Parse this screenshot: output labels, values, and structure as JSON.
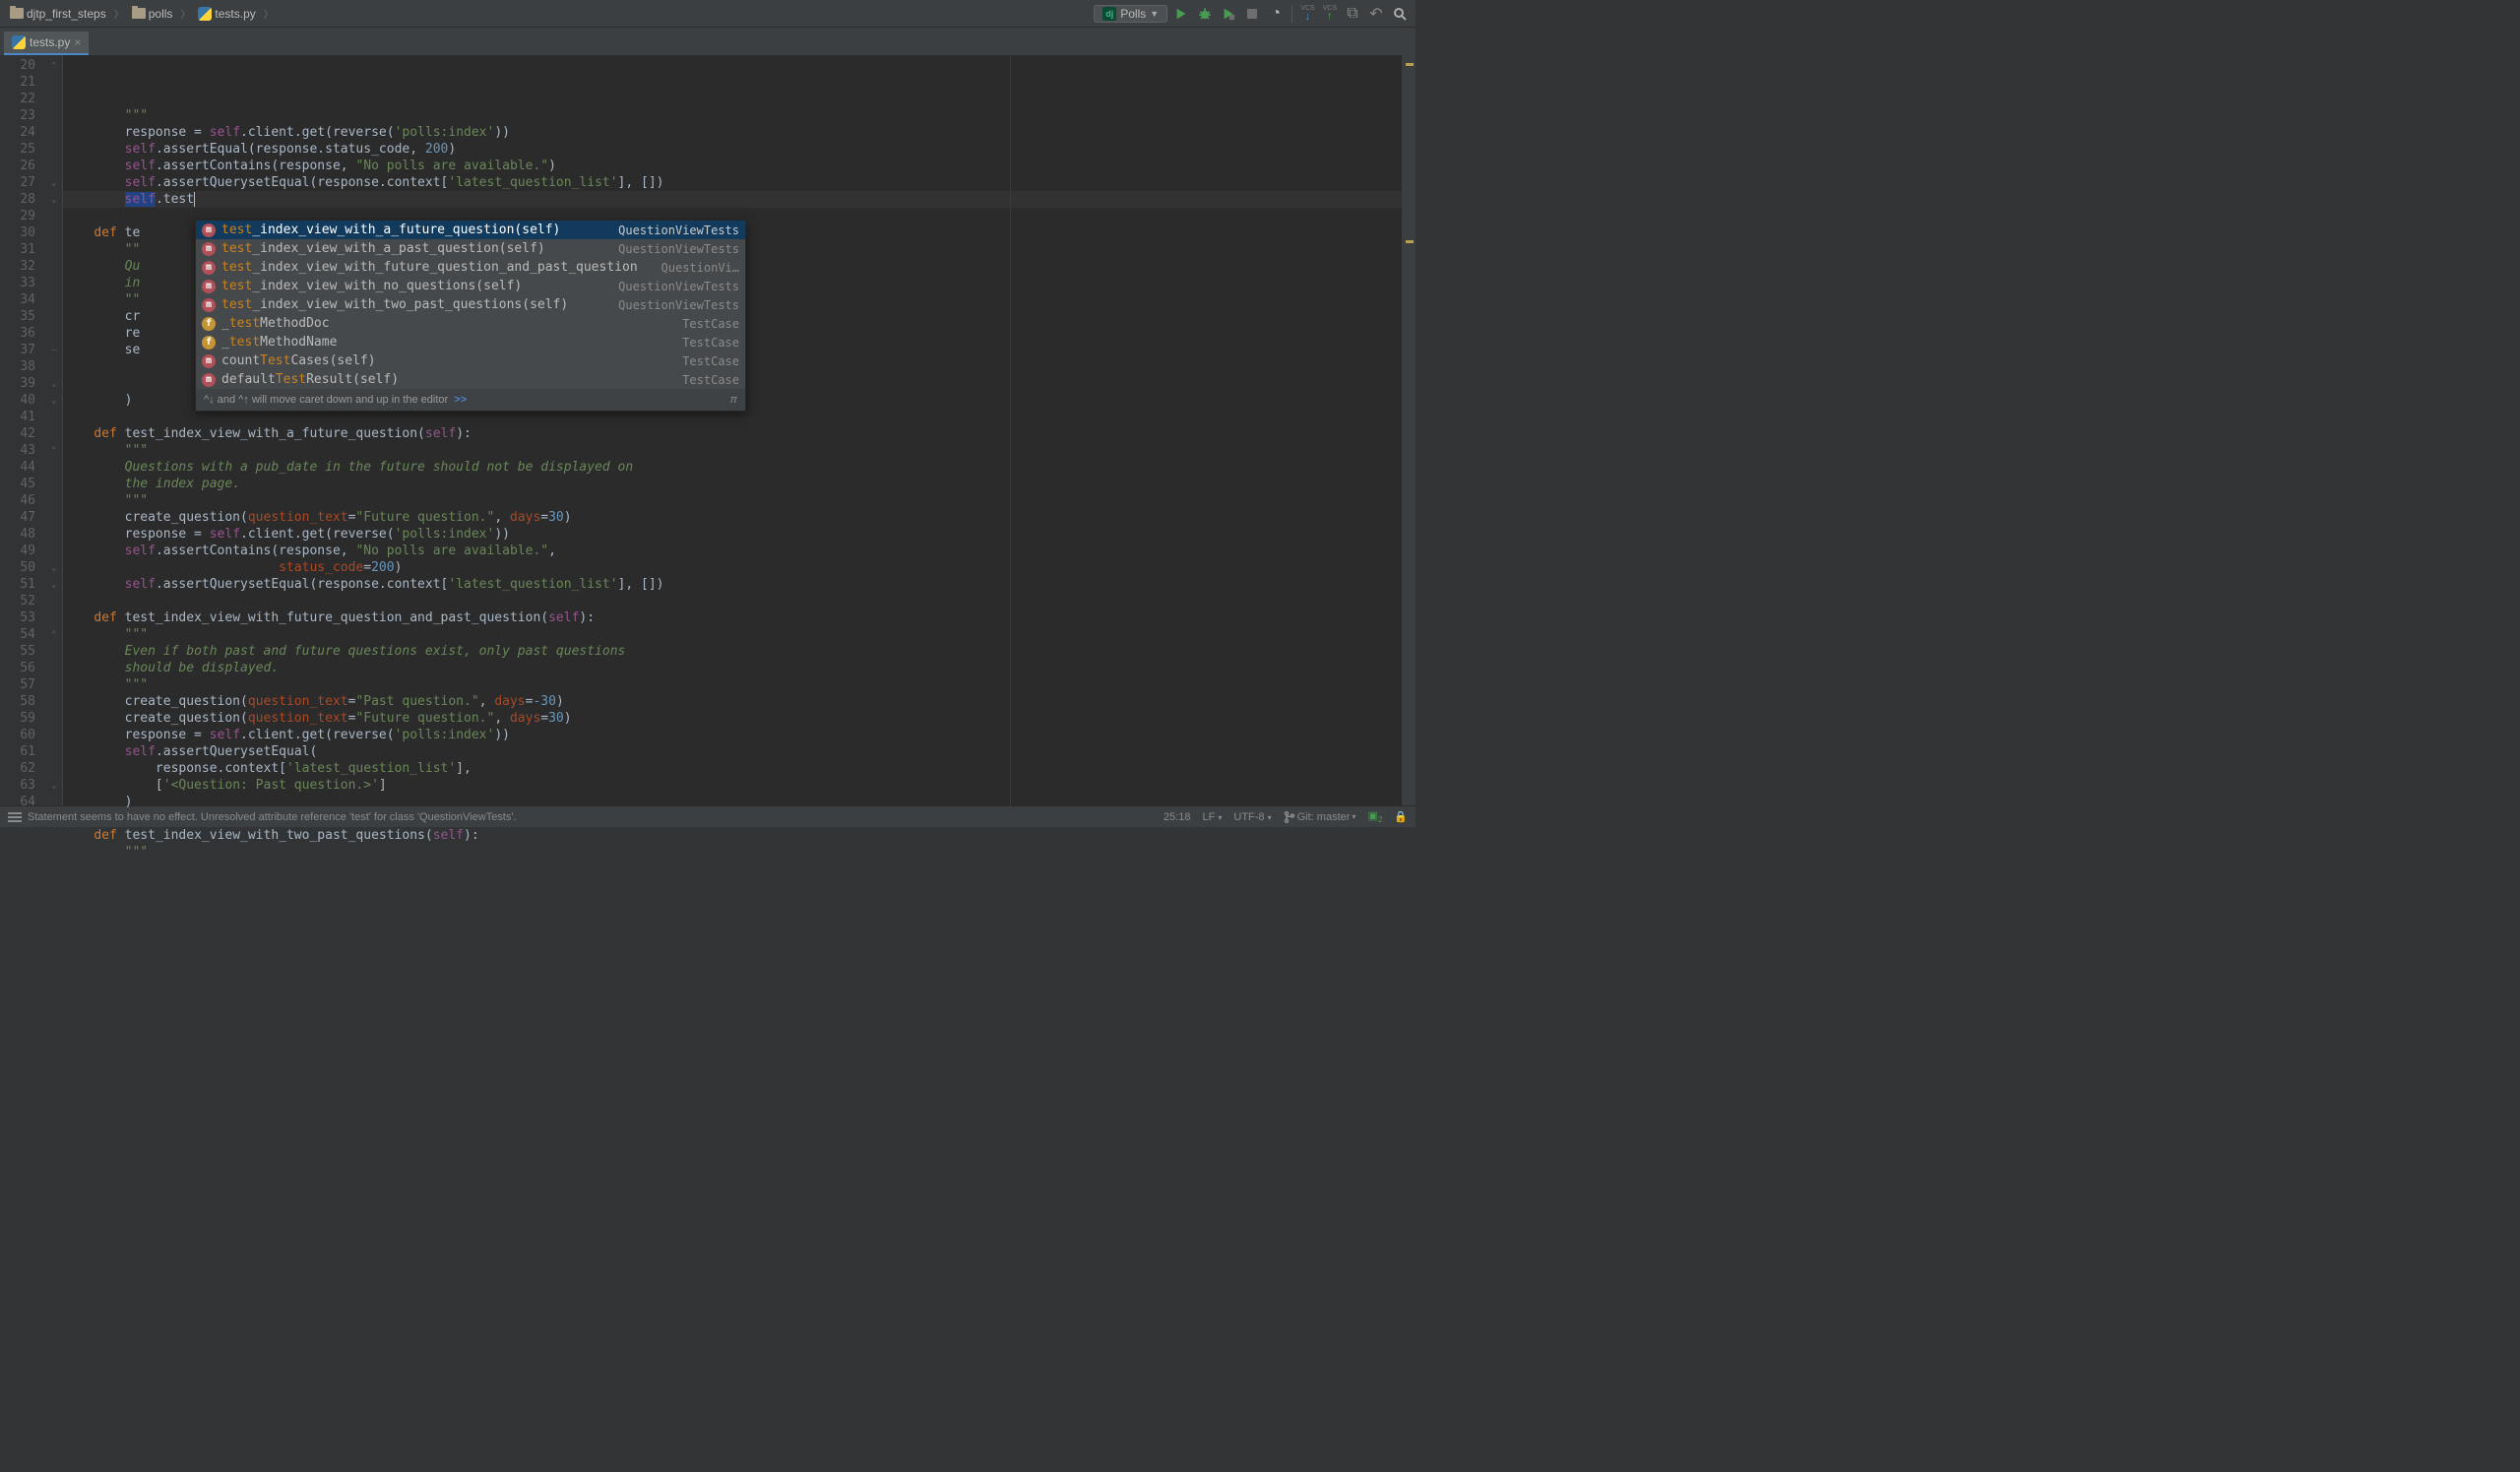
{
  "breadcrumbs": [
    {
      "icon": "folder",
      "label": "djtp_first_steps"
    },
    {
      "icon": "folder",
      "label": "polls"
    },
    {
      "icon": "py",
      "label": "tests.py"
    }
  ],
  "run_config": "Polls",
  "editor_tab": {
    "name": "tests.py"
  },
  "gutter_start": 20,
  "gutter_end": 64,
  "code_lines": [
    {
      "n": 20,
      "html": "        <span class='tok-docq'>\"\"\"</span>"
    },
    {
      "n": 21,
      "html": "        response = <span class='tok-self'>self</span>.client.get(reverse(<span class='tok-str'>'polls:index'</span>))"
    },
    {
      "n": 22,
      "html": "        <span class='tok-self'>self</span>.assertEqual(response.status_code, <span class='tok-num'>200</span>)"
    },
    {
      "n": 23,
      "html": "        <span class='tok-self'>self</span>.assertContains(response, <span class='tok-str'>\"No polls are available.\"</span>)"
    },
    {
      "n": 24,
      "html": "        <span class='tok-self'>self</span>.assertQuerysetEqual(response.context[<span class='tok-str'>'latest_question_list'</span>], [])"
    },
    {
      "n": 25,
      "hl": true,
      "html": "        <span class='sel-word'><span class='tok-self'>self</span></span>.test<span class='caret'></span>"
    },
    {
      "n": 26,
      "html": ""
    },
    {
      "n": 27,
      "html": "    <span class='tok-kw'>def</span> <span class='tok-fn'>te</span>"
    },
    {
      "n": 28,
      "html": "        <span class='tok-docq'>\"\"</span>"
    },
    {
      "n": 29,
      "html": "        <span class='tok-doc'>Qu</span>"
    },
    {
      "n": 30,
      "html": "        <span class='tok-doc'>in</span>"
    },
    {
      "n": 31,
      "html": "        <span class='tok-docq'>\"\"</span>"
    },
    {
      "n": 32,
      "html": "        cr"
    },
    {
      "n": 33,
      "html": "        re"
    },
    {
      "n": 34,
      "html": "        se"
    },
    {
      "n": 35,
      "html": ""
    },
    {
      "n": 36,
      "html": ""
    },
    {
      "n": 37,
      "html": "        )"
    },
    {
      "n": 38,
      "html": ""
    },
    {
      "n": 39,
      "html": "    <span class='tok-kw'>def</span> <span class='tok-fn'>test_index_view_with_a_future_question</span>(<span class='tok-self'>self</span>):"
    },
    {
      "n": 40,
      "html": "        <span class='tok-docq'>\"\"\"</span>"
    },
    {
      "n": 41,
      "html": "        <span class='tok-doc'>Questions with a pub_date in the future should not be displayed on</span>"
    },
    {
      "n": 42,
      "html": "        <span class='tok-doc'>the index page.</span>"
    },
    {
      "n": 43,
      "html": "        <span class='tok-docq'>\"\"\"</span>"
    },
    {
      "n": 44,
      "html": "        create_question(<span class='tok-param'>question_text</span>=<span class='tok-str'>\"Future question.\"</span>, <span class='tok-param'>days</span>=<span class='tok-num'>30</span>)"
    },
    {
      "n": 45,
      "html": "        response = <span class='tok-self'>self</span>.client.get(reverse(<span class='tok-str'>'polls:index'</span>))"
    },
    {
      "n": 46,
      "html": "        <span class='tok-self'>self</span>.assertContains(response, <span class='tok-str'>\"No polls are available.\"</span>,"
    },
    {
      "n": 47,
      "html": "                            <span class='tok-param'>status_code</span>=<span class='tok-num'>200</span>)"
    },
    {
      "n": 48,
      "html": "        <span class='tok-self'>self</span>.assertQuerysetEqual(response.context[<span class='tok-str'>'latest_question_list'</span>], [])"
    },
    {
      "n": 49,
      "html": ""
    },
    {
      "n": 50,
      "html": "    <span class='tok-kw'>def</span> <span class='tok-fn'>test_index_view_with_future_question_and_past_question</span>(<span class='tok-self'>self</span>):"
    },
    {
      "n": 51,
      "html": "        <span class='tok-docq'>\"\"\"</span>"
    },
    {
      "n": 52,
      "html": "        <span class='tok-doc'>Even if both past and future questions exist, only past questions</span>"
    },
    {
      "n": 53,
      "html": "        <span class='tok-doc'>should be displayed.</span>"
    },
    {
      "n": 54,
      "html": "        <span class='tok-docq'>\"\"\"</span>"
    },
    {
      "n": 55,
      "html": "        create_question(<span class='tok-param'>question_text</span>=<span class='tok-str'>\"Past question.\"</span>, <span class='tok-param'>days</span>=<span class='tok-num'>-30</span>)"
    },
    {
      "n": 56,
      "html": "        create_question(<span class='tok-param'>question_text</span>=<span class='tok-str'>\"Future question.\"</span>, <span class='tok-param'>days</span>=<span class='tok-num'>30</span>)"
    },
    {
      "n": 57,
      "html": "        response = <span class='tok-self'>self</span>.client.get(reverse(<span class='tok-str'>'polls:index'</span>))"
    },
    {
      "n": 58,
      "html": "        <span class='tok-self'>self</span>.assertQuerysetEqual("
    },
    {
      "n": 59,
      "html": "            response.context[<span class='tok-str'>'latest_question_list'</span>],"
    },
    {
      "n": 60,
      "html": "            [<span class='tok-str'>'&lt;Question: Past question.&gt;'</span>]"
    },
    {
      "n": 61,
      "html": "        )"
    },
    {
      "n": 62,
      "html": ""
    },
    {
      "n": 63,
      "html": "    <span class='tok-kw'>def</span> <span class='tok-fn'>test_index_view_with_two_past_questions</span>(<span class='tok-self'>self</span>):"
    },
    {
      "n": 64,
      "html": "        <span class='tok-docq'>\"\"\"</span>"
    }
  ],
  "autocomplete": {
    "items": [
      {
        "badge": "m",
        "label": "test_index_view_with_a_future_question(self)",
        "match": "test",
        "cls": "QuestionViewTests",
        "selected": true
      },
      {
        "badge": "m",
        "label": "test_index_view_with_a_past_question(self)",
        "match": "test",
        "cls": "QuestionViewTests"
      },
      {
        "badge": "m",
        "label": "test_index_view_with_future_question_and_past_question",
        "match": "test",
        "cls": "QuestionVi…"
      },
      {
        "badge": "m",
        "label": "test_index_view_with_no_questions(self)",
        "match": "test",
        "cls": "QuestionViewTests"
      },
      {
        "badge": "m",
        "label": "test_index_view_with_two_past_questions(self)",
        "match": "test",
        "cls": "QuestionViewTests"
      },
      {
        "badge": "f",
        "label": "_testMethodDoc",
        "match": "test",
        "cls": "TestCase"
      },
      {
        "badge": "f",
        "label": "_testMethodName",
        "match": "test",
        "cls": "TestCase"
      },
      {
        "badge": "m",
        "label": "countTestCases(self)",
        "match": "Test",
        "cls": "TestCase"
      },
      {
        "badge": "m",
        "label": "defaultTestResult(self)",
        "match": "Test",
        "cls": "TestCase"
      }
    ],
    "footer_hint": "^↓ and ^↑ will move caret down and up in the editor",
    "footer_link": ">>",
    "footer_pi": "π"
  },
  "status": {
    "message": "Statement seems to have no effect. Unresolved attribute reference 'test' for class 'QuestionViewTests'.",
    "pos": "25:18",
    "line_sep": "LF",
    "encoding": "UTF-8",
    "git": "Git: master"
  }
}
